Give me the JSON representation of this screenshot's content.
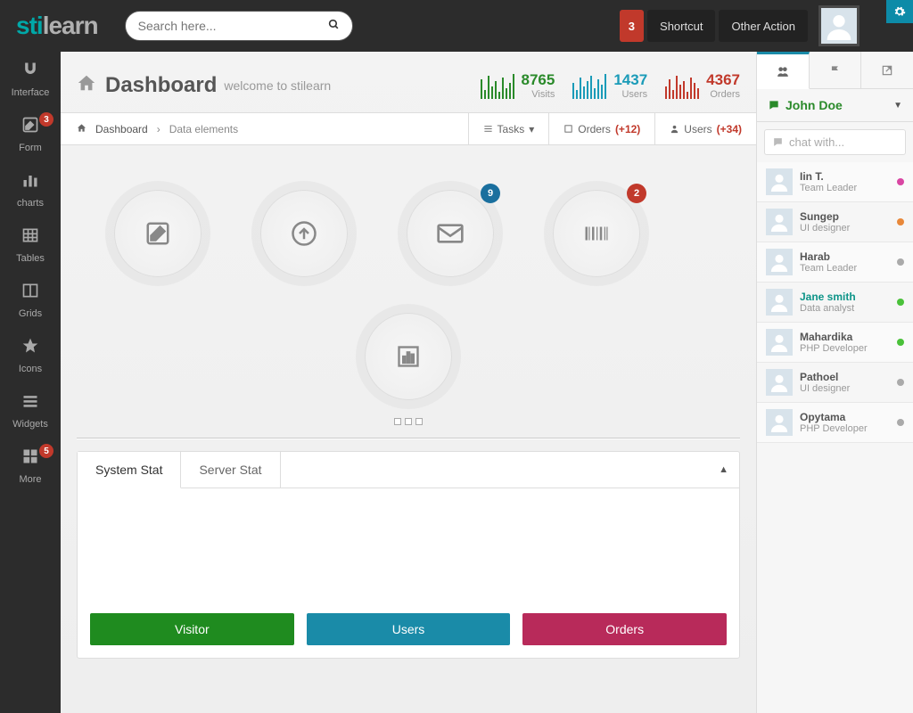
{
  "logo": {
    "p1": "sti",
    "p2": "learn"
  },
  "search": {
    "placeholder": "Search here..."
  },
  "header": {
    "badge": "3",
    "shortcut": "Shortcut",
    "other": "Other Action"
  },
  "sidebar": [
    {
      "label": "Interface",
      "icon": "magnet"
    },
    {
      "label": "Form",
      "icon": "edit",
      "badge": "3"
    },
    {
      "label": "charts",
      "icon": "bar"
    },
    {
      "label": "Tables",
      "icon": "table"
    },
    {
      "label": "Grids",
      "icon": "columns"
    },
    {
      "label": "Icons",
      "icon": "star"
    },
    {
      "label": "Widgets",
      "icon": "list"
    },
    {
      "label": "More",
      "icon": "grid",
      "badge": "5"
    }
  ],
  "title": {
    "main": "Dashboard",
    "sub": "welcome to stilearn"
  },
  "stats": {
    "visits": {
      "num": "8765",
      "label": "Visits"
    },
    "users": {
      "num": "1437",
      "label": "Users"
    },
    "orders": {
      "num": "4367",
      "label": "Orders"
    }
  },
  "crumb": {
    "home": "Dashboard",
    "current": "Data elements"
  },
  "crumb_actions": {
    "tasks": "Tasks",
    "orders": "Orders",
    "orders_plus": "(+12)",
    "users": "Users",
    "users_plus": "(+34)"
  },
  "shortcuts": {
    "mail_badge": "9",
    "barcode_badge": "2"
  },
  "tabs": {
    "system": "System Stat",
    "server": "Server Stat"
  },
  "big_buttons": {
    "visitor": "Visitor",
    "users": "Users",
    "orders": "Orders"
  },
  "chat": {
    "user": "John Doe",
    "placeholder": "chat with...",
    "contacts": [
      {
        "name": "Iin T.",
        "role": "Team Leader",
        "status": "pink"
      },
      {
        "name": "Sungep",
        "role": "UI designer",
        "status": "orange"
      },
      {
        "name": "Harab",
        "role": "Team Leader",
        "status": "gray"
      },
      {
        "name": "Jane smith",
        "role": "Data analyst",
        "status": "green",
        "teal": true
      },
      {
        "name": "Mahardika",
        "role": "PHP Developer",
        "status": "green"
      },
      {
        "name": "Pathoel",
        "role": "UI designer",
        "status": "gray"
      },
      {
        "name": "Opytama",
        "role": "PHP Developer",
        "status": "gray"
      }
    ]
  }
}
